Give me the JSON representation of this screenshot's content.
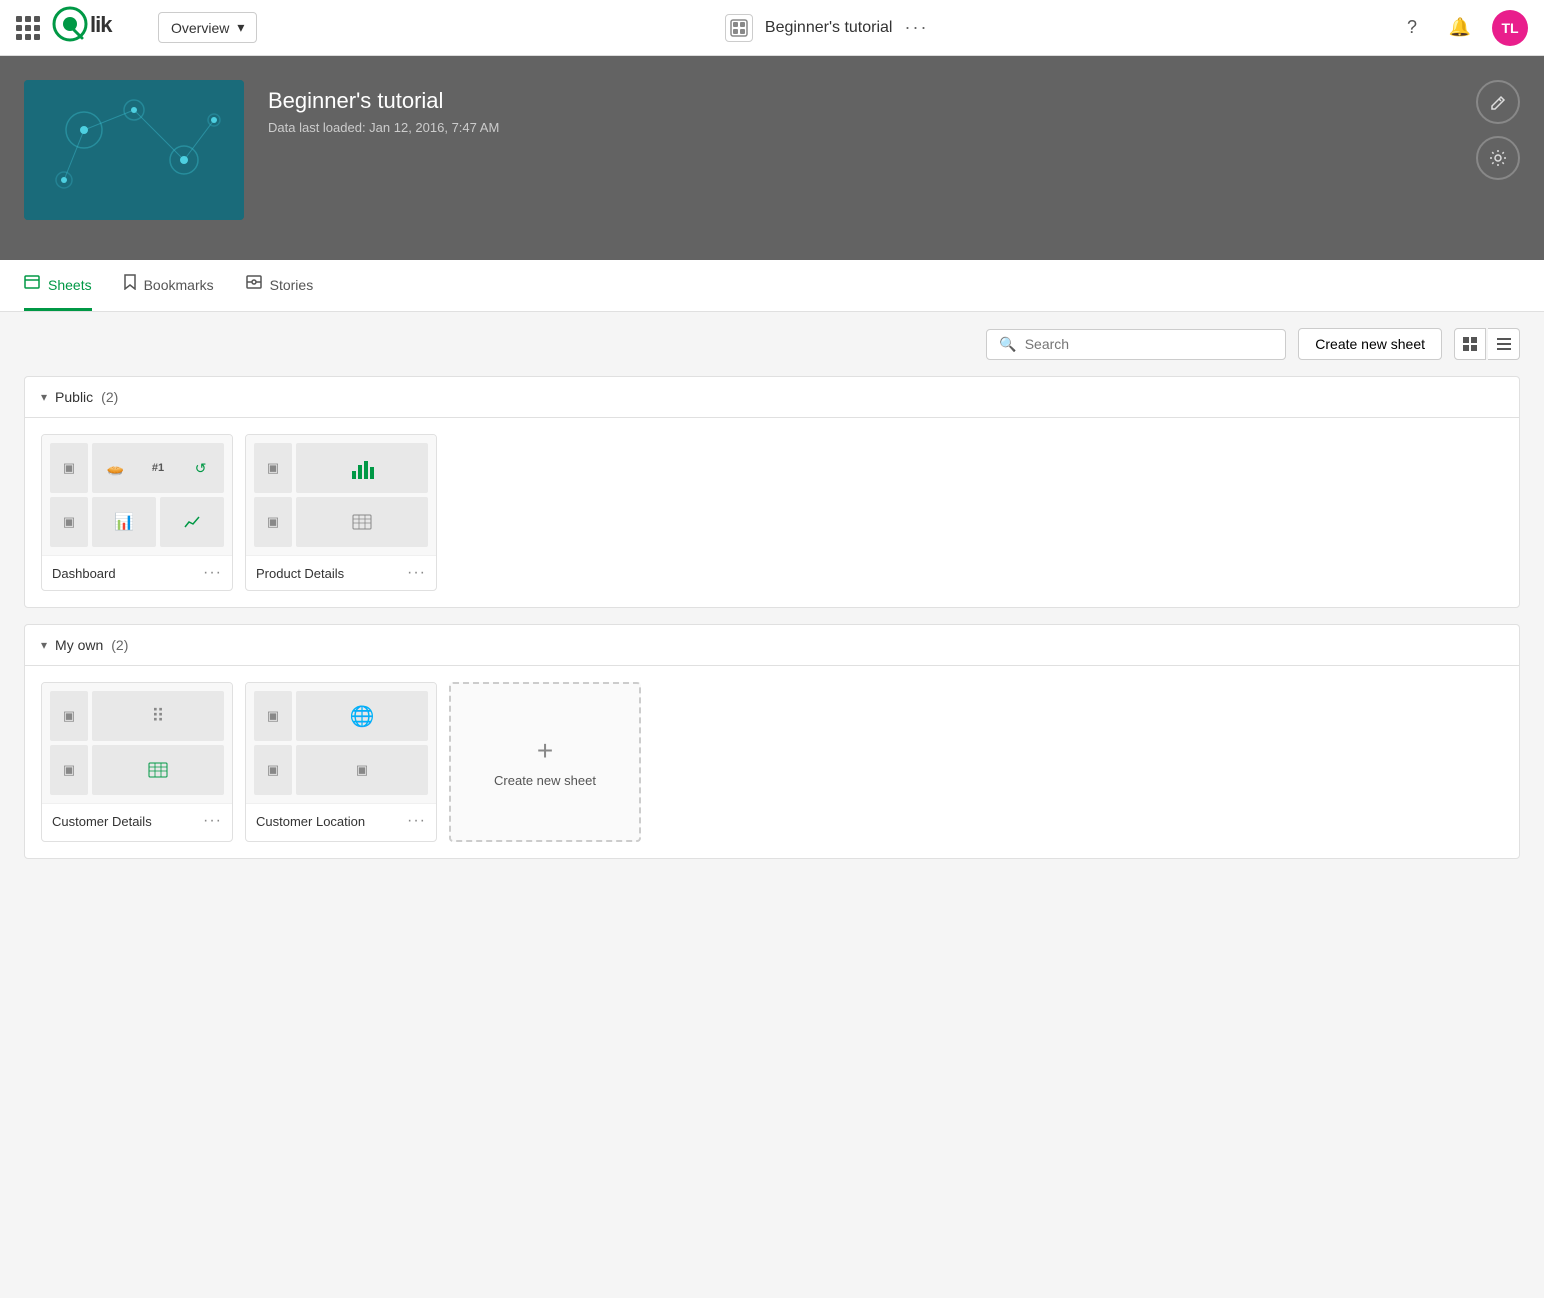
{
  "topnav": {
    "dropdown_value": "Overview",
    "app_title": "Beginner's tutorial",
    "dots_label": "···",
    "avatar_initials": "TL",
    "avatar_color": "#e91e8c"
  },
  "hero": {
    "title": "Beginner's tutorial",
    "subtitle": "Data last loaded: Jan 12, 2016, 7:47 AM",
    "edit_btn_label": "✎",
    "settings_btn_label": "⚙"
  },
  "tabs": [
    {
      "id": "sheets",
      "label": "Sheets",
      "active": true
    },
    {
      "id": "bookmarks",
      "label": "Bookmarks",
      "active": false
    },
    {
      "id": "stories",
      "label": "Stories",
      "active": false
    }
  ],
  "toolbar": {
    "search_placeholder": "Search",
    "create_sheet_label": "Create new sheet",
    "grid_view_icon": "⊞",
    "list_view_icon": "☰"
  },
  "sections": [
    {
      "id": "public",
      "label": "Public",
      "count": "(2)",
      "sheets": [
        {
          "name": "Dashboard",
          "has_menu": true
        },
        {
          "name": "Product Details",
          "has_menu": true
        }
      ]
    },
    {
      "id": "my-own",
      "label": "My own",
      "count": "(2)",
      "sheets": [
        {
          "name": "Customer Details",
          "has_menu": true
        },
        {
          "name": "Customer Location",
          "has_menu": true
        }
      ],
      "show_create": true,
      "create_label": "Create new sheet"
    }
  ]
}
